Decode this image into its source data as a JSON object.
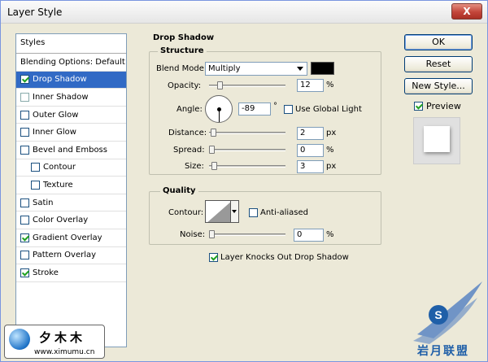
{
  "window": {
    "title": "Layer Style",
    "close_label": "X"
  },
  "styles": {
    "header": "Styles",
    "items": [
      {
        "label": "Blending Options: Default",
        "checkbox": false,
        "checked": false,
        "selected": false,
        "indent": false
      },
      {
        "label": "Drop Shadow",
        "checkbox": true,
        "checked": true,
        "selected": true,
        "indent": false
      },
      {
        "label": "Inner Shadow",
        "checkbox": true,
        "checked": false,
        "selected": false,
        "indent": false
      },
      {
        "label": "Outer Glow",
        "checkbox": true,
        "checked": false,
        "selected": false,
        "indent": false
      },
      {
        "label": "Inner Glow",
        "checkbox": true,
        "checked": false,
        "selected": false,
        "indent": false
      },
      {
        "label": "Bevel and Emboss",
        "checkbox": true,
        "checked": false,
        "selected": false,
        "indent": false
      },
      {
        "label": "Contour",
        "checkbox": true,
        "checked": false,
        "selected": false,
        "indent": true
      },
      {
        "label": "Texture",
        "checkbox": true,
        "checked": false,
        "selected": false,
        "indent": true
      },
      {
        "label": "Satin",
        "checkbox": true,
        "checked": false,
        "selected": false,
        "indent": false
      },
      {
        "label": "Color Overlay",
        "checkbox": true,
        "checked": false,
        "selected": false,
        "indent": false
      },
      {
        "label": "Gradient Overlay",
        "checkbox": true,
        "checked": true,
        "selected": false,
        "indent": false
      },
      {
        "label": "Pattern Overlay",
        "checkbox": true,
        "checked": false,
        "selected": false,
        "indent": false
      },
      {
        "label": "Stroke",
        "checkbox": true,
        "checked": true,
        "selected": false,
        "indent": false
      }
    ]
  },
  "drop_shadow": {
    "section_title": "Drop Shadow",
    "structure": {
      "title": "Structure",
      "blend_mode_label": "Blend Mode:",
      "blend_mode_value": "Multiply",
      "shadow_color": "#000000",
      "opacity_label": "Opacity:",
      "opacity_value": "12",
      "opacity_unit": "%",
      "opacity_level": 0.12,
      "angle_label": "Angle:",
      "angle_value": "-89",
      "angle_unit": "°",
      "global_light_label": "Use Global Light",
      "global_light_checked": false,
      "distance_label": "Distance:",
      "distance_value": "2",
      "distance_unit": "px",
      "distance_level": 0.02,
      "spread_label": "Spread:",
      "spread_value": "0",
      "spread_unit": "%",
      "spread_level": 0.0,
      "size_label": "Size:",
      "size_value": "3",
      "size_unit": "px",
      "size_level": 0.03
    },
    "quality": {
      "title": "Quality",
      "contour_label": "Contour:",
      "anti_aliased_label": "Anti-aliased",
      "anti_aliased_checked": false,
      "noise_label": "Noise:",
      "noise_value": "0",
      "noise_unit": "%",
      "noise_level": 0.0
    },
    "knockout_label": "Layer Knocks Out Drop Shadow",
    "knockout_checked": true
  },
  "buttons": {
    "ok": "OK",
    "reset": "Reset",
    "new_style": "New Style...",
    "preview_label": "Preview",
    "preview_checked": true
  },
  "watermark": {
    "left_chars": "夕木木",
    "left_url": "www.ximumu.cn",
    "right_text": "岩月联盟",
    "right_badge": "S"
  },
  "colors": {
    "selection": "#316ac5",
    "accent_blue": "#1f5fa8"
  }
}
